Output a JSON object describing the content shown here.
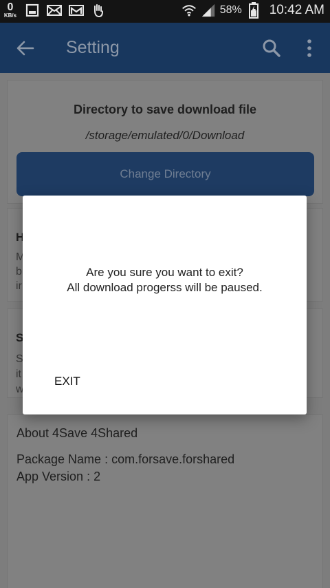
{
  "status_bar": {
    "network_speed": "0",
    "network_unit": "KB/s",
    "battery_percent": "58%",
    "time": "10:42 AM",
    "icons": [
      "gallery-icon",
      "mail-icon",
      "gmail-icon",
      "hand-icon",
      "wifi-icon",
      "signal-icon",
      "battery-icon"
    ]
  },
  "app_bar": {
    "title": "Setting",
    "back_icon": "arrow-left-icon",
    "search_icon": "search-icon",
    "more_icon": "more-vertical-icon"
  },
  "directory_card": {
    "title": "Directory to save download file",
    "path": "/storage/emulated/0/Download",
    "button_label": "Change Directory"
  },
  "card2": {
    "heading": "H",
    "lines": [
      "M",
      "b",
      "ir"
    ]
  },
  "card3": {
    "heading": "S",
    "lines": [
      "S",
      "it",
      "w"
    ]
  },
  "about_card": {
    "title": "About 4Save 4Shared",
    "package": "Package Name : com.forsave.forshared",
    "version": "App Version : 2"
  },
  "dialog": {
    "line1": "Are you sure you want to exit?",
    "line2": "All download progerss will be paused.",
    "exit_label": "EXIT"
  },
  "colors": {
    "app_bar": "#18375e",
    "dialog_bg": "#ffffff",
    "dim_overlay": "#7d7d7d"
  }
}
